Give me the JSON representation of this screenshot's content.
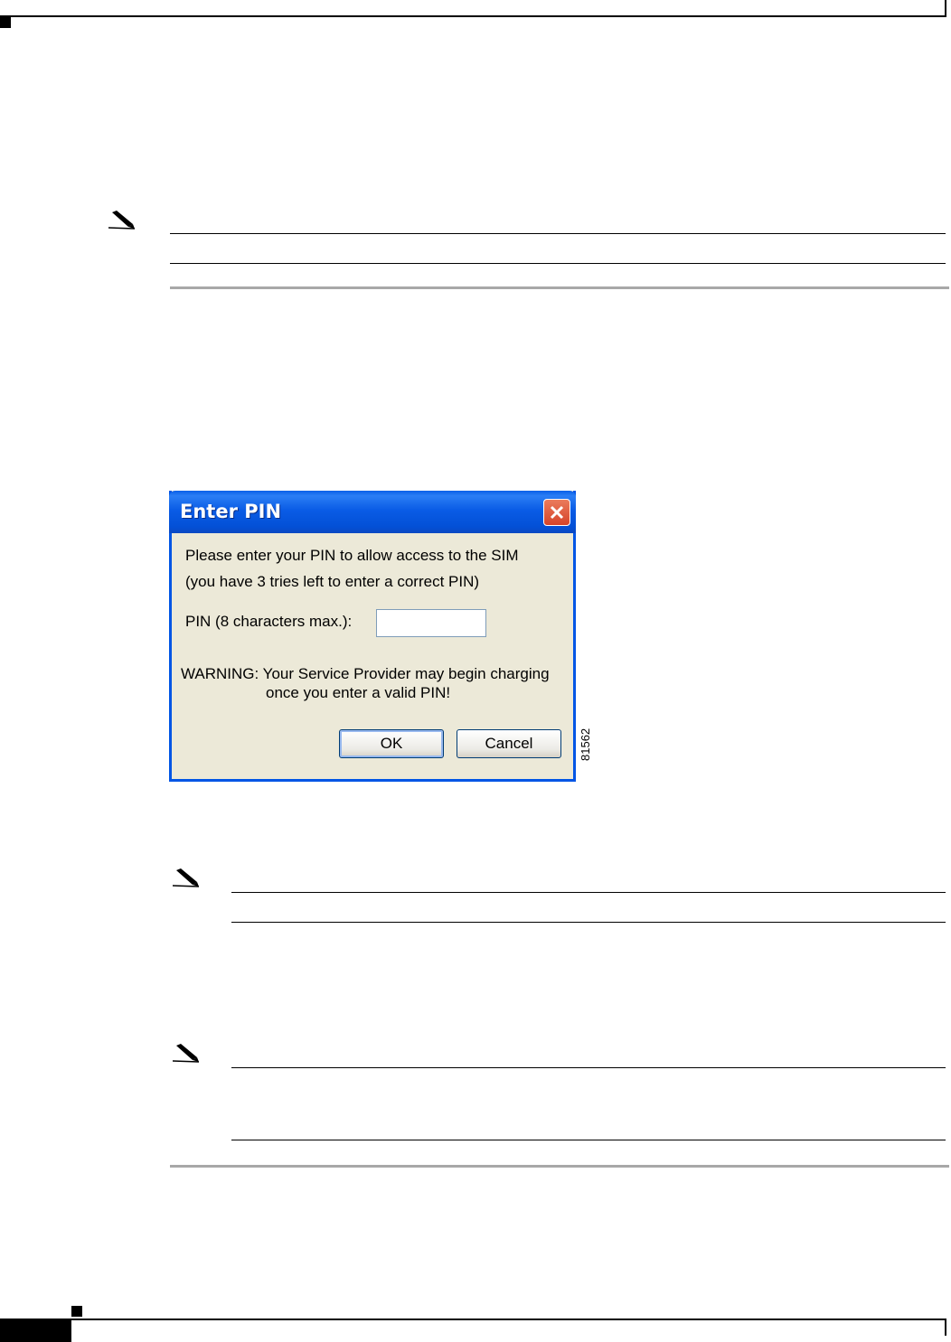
{
  "dialog": {
    "title": "Enter PIN",
    "prompt_line1": "Please enter your PIN to allow access to the SIM",
    "prompt_line2": "(you have 3 tries left to enter a correct PIN)",
    "pin_label": "PIN (8 characters max.):",
    "pin_value": "",
    "warning_line1": "WARNING: Your Service Provider may begin charging",
    "warning_line2": "once you enter a valid PIN!",
    "ok_label": "OK",
    "cancel_label": "Cancel"
  },
  "figure_number": "81562"
}
